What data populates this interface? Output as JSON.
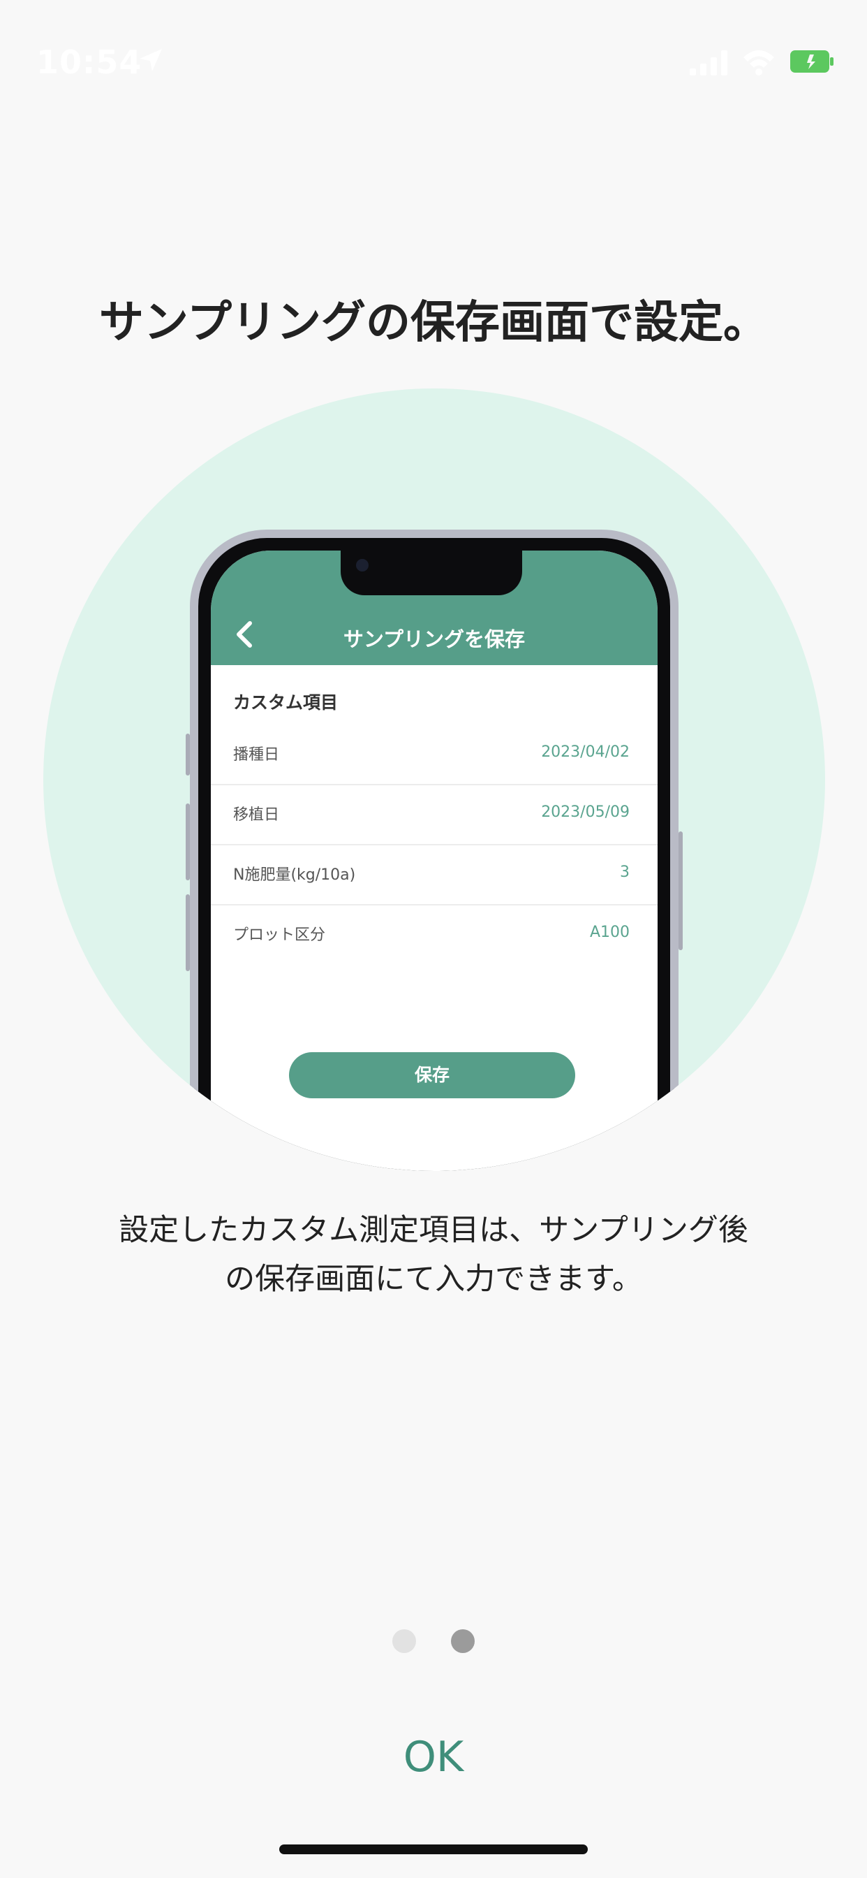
{
  "status_bar": {
    "time": "10:54",
    "icons": [
      "location-arrow-icon",
      "signal-icon",
      "wifi-icon",
      "battery-icon"
    ]
  },
  "title": "サンプリングの保存画面で設定。",
  "illustration": {
    "header_title": "サンプリングを保存",
    "section_title": "カスタム項目",
    "rows": [
      {
        "label": "播種日",
        "value": "2023/04/02"
      },
      {
        "label": "移植日",
        "value": "2023/05/09"
      },
      {
        "label": "N施肥量(kg/10a)",
        "value": "3"
      },
      {
        "label": "プロット区分",
        "value": "A100"
      }
    ],
    "save_label": "保存"
  },
  "description_lines": [
    "設定したカスタム測定項目は、サンプリング後",
    "の保存画面にて入力できます。"
  ],
  "pager": {
    "total": 2,
    "current": 2
  },
  "ok_label": "OK",
  "colors": {
    "accent": "#569e89",
    "circle": "#def4ec",
    "value_text": "#5aa48f",
    "ok_text": "#3f8e7a",
    "battery": "#5cc85f"
  }
}
